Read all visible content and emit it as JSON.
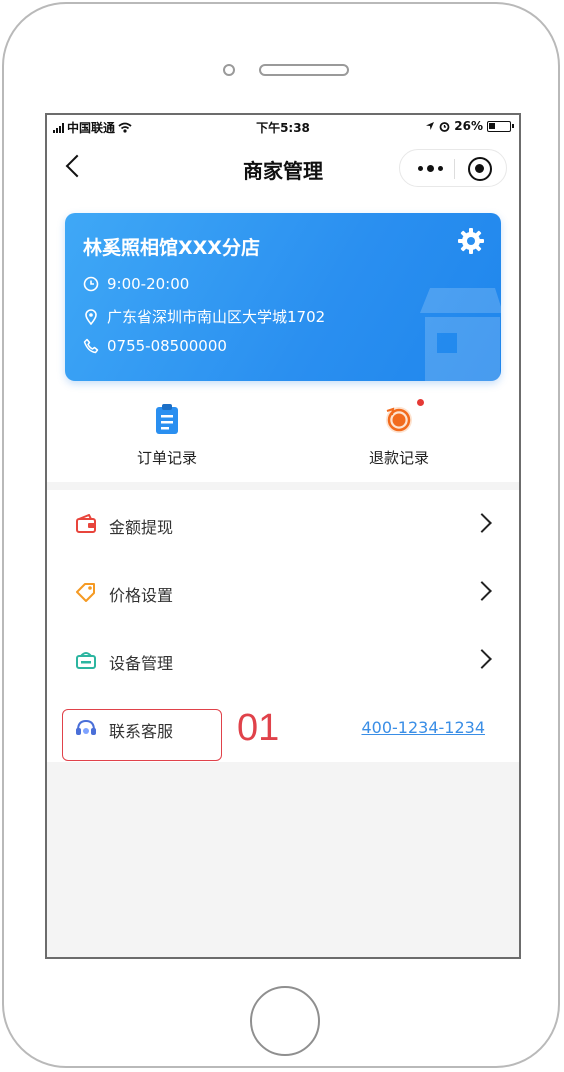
{
  "status_bar": {
    "carrier": "中国联通",
    "time": "下午5:38",
    "battery": "26%"
  },
  "nav": {
    "title": "商家管理"
  },
  "shop": {
    "name": "林奚照相馆XXX分店",
    "hours": "9:00-20:00",
    "address": "广东省深圳市南山区大学城1702",
    "phone": "0755-08500000"
  },
  "quick_actions": [
    {
      "label": "订单记录",
      "icon": "clipboard-icon"
    },
    {
      "label": "退款记录",
      "icon": "refund-icon",
      "badge": true
    }
  ],
  "menu": [
    {
      "label": "金额提现",
      "icon": "wallet-icon"
    },
    {
      "label": "价格设置",
      "icon": "price-tag-icon"
    },
    {
      "label": "设备管理",
      "icon": "device-icon"
    },
    {
      "label": "联系客服",
      "icon": "customer-service-icon",
      "value": "400-1234-1234"
    }
  ],
  "annotation": {
    "step": "01"
  },
  "colors": {
    "card_blue": "#2a8ff0",
    "accent_red": "#e0424a",
    "link_blue": "#3a8ee6"
  }
}
